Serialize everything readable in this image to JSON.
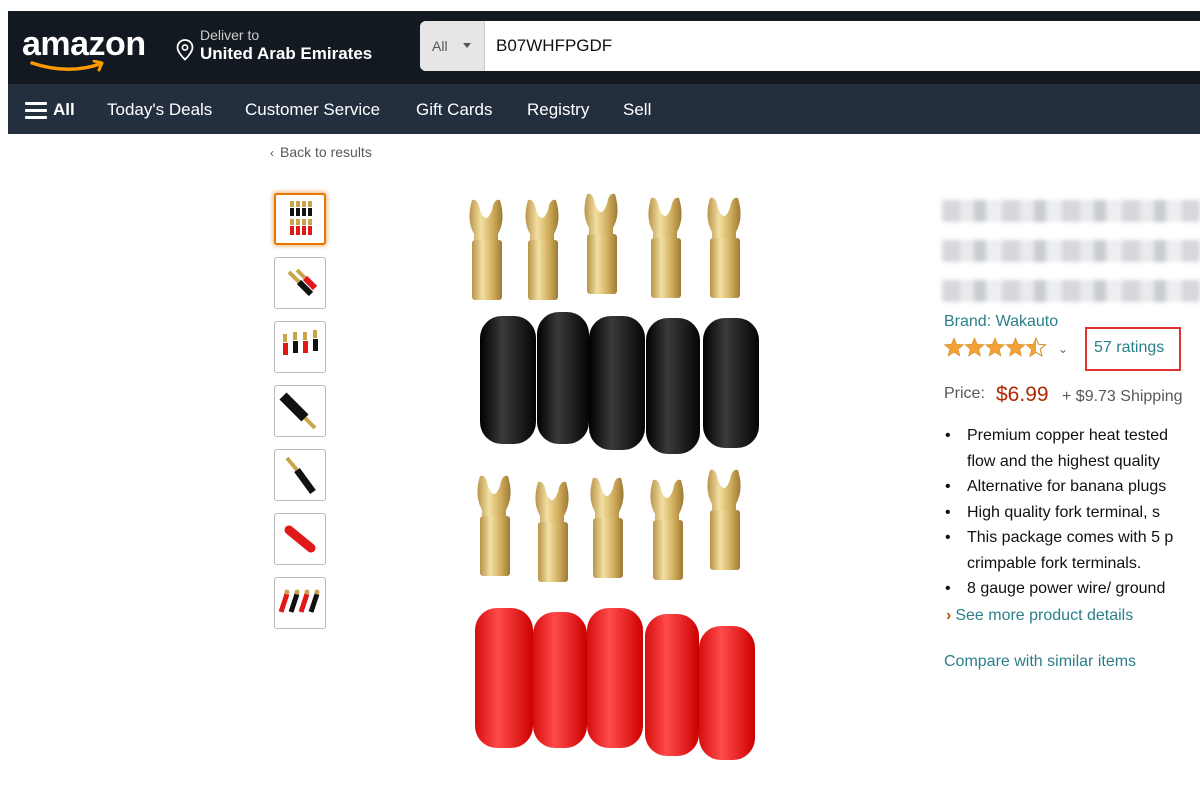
{
  "header": {
    "logo": "amazon",
    "deliver_small": "Deliver to",
    "deliver_location": "United Arab Emirates",
    "search_category": "All",
    "search_value": "B07WHFPGDF"
  },
  "nav": {
    "all_label": "All",
    "items": [
      "Today's Deals",
      "Customer Service",
      "Gift Cards",
      "Registry",
      "Sell"
    ]
  },
  "back_link": "Back to results",
  "product": {
    "brand": "Brand: Wakauto",
    "rating_stars": 4.5,
    "ratings_count": "57 ratings",
    "price_label": "Price:",
    "price": "$6.99",
    "shipping": "+ $9.73 Shipping",
    "bullets": [
      [
        "Premium copper heat tested",
        "flow and the highest quality"
      ],
      [
        "Alternative for banana plugs"
      ],
      [
        "High quality fork terminal, s"
      ],
      [
        "This package comes with 5 p",
        "crimpable fork terminals."
      ],
      [
        "8 gauge power wire/ ground"
      ]
    ],
    "see_more": "See more product details",
    "compare": "Compare with similar items"
  },
  "colors": {
    "header_bg": "#131921",
    "subnav_bg": "#232f3e",
    "link": "#2a7f89",
    "price": "#b12704",
    "star": "#f2a236",
    "highlight_box": "#e03232"
  }
}
